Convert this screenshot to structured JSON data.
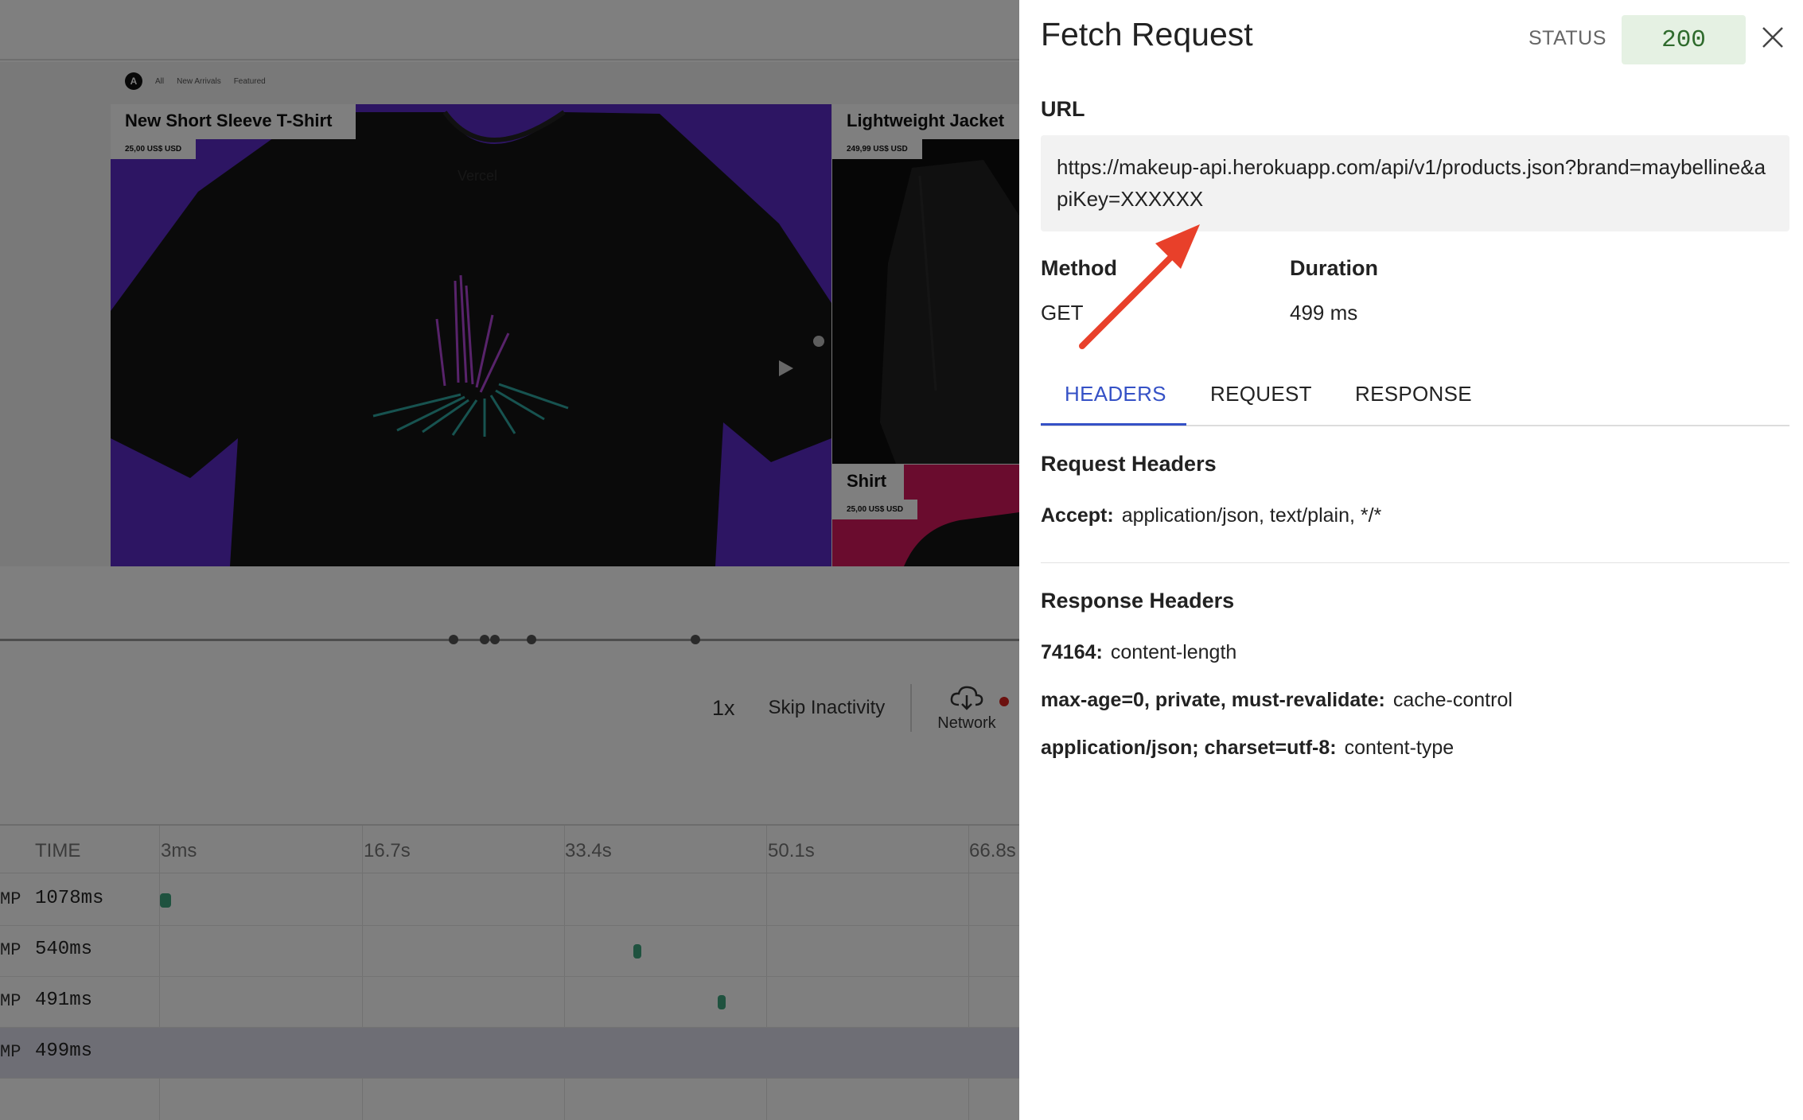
{
  "replay": {
    "store_nav": {
      "logo": "A",
      "links": [
        "All",
        "New Arrivals",
        "Featured"
      ]
    },
    "products": [
      {
        "name": "New Short Sleeve T-Shirt",
        "price": "25,00 US$ USD",
        "print": "Vercel"
      },
      {
        "name": "Lightweight Jacket",
        "price": "249,99 US$ USD"
      },
      {
        "name": "Shirt",
        "price": "25,00 US$ USD"
      }
    ],
    "controls": {
      "speed": "1x",
      "skip": "Skip Inactivity",
      "network": "Network"
    },
    "network_table": {
      "time_header": "TIME",
      "ticks": [
        "3ms",
        "16.7s",
        "33.4s",
        "50.1s",
        "66.8s"
      ],
      "rows": [
        {
          "prefix": "MP",
          "duration": "1078ms"
        },
        {
          "prefix": "MP",
          "duration": "540ms"
        },
        {
          "prefix": "MP",
          "duration": "491ms"
        },
        {
          "prefix": "MP",
          "duration": "499ms",
          "selected": true
        }
      ]
    }
  },
  "panel": {
    "title": "Fetch Request",
    "status_label": "STATUS",
    "status_code": "200",
    "url_label": "URL",
    "url": "https://makeup-api.herokuapp.com/api/v1/products.json?brand=maybelline&apiKey=XXXXXX",
    "method_label": "Method",
    "method": "GET",
    "duration_label": "Duration",
    "duration": "499 ms",
    "tabs": [
      "HEADERS",
      "REQUEST",
      "RESPONSE"
    ],
    "active_tab": "HEADERS",
    "request_headers_title": "Request Headers",
    "request_headers": [
      {
        "key": "Accept:",
        "value": "application/json, text/plain, */*"
      }
    ],
    "response_headers_title": "Response Headers",
    "response_headers": [
      {
        "key": "74164:",
        "value": "content-length"
      },
      {
        "key": "max-age=0, private, must-revalidate:",
        "value": "cache-control"
      },
      {
        "key": "application/json; charset=utf-8:",
        "value": "content-type"
      }
    ]
  },
  "colors": {
    "accent": "#3551c6",
    "status_bg": "#e5f1e3",
    "status_text": "#2f6b2d",
    "annotation_arrow": "#e8402a",
    "product_purple": "#5a2bc7",
    "product_pink": "#d4185c",
    "network_dot": "#d9231e"
  },
  "icons": {
    "close": "close-icon",
    "network": "cloud-download-icon",
    "annotation": "red-arrow-annotation"
  }
}
